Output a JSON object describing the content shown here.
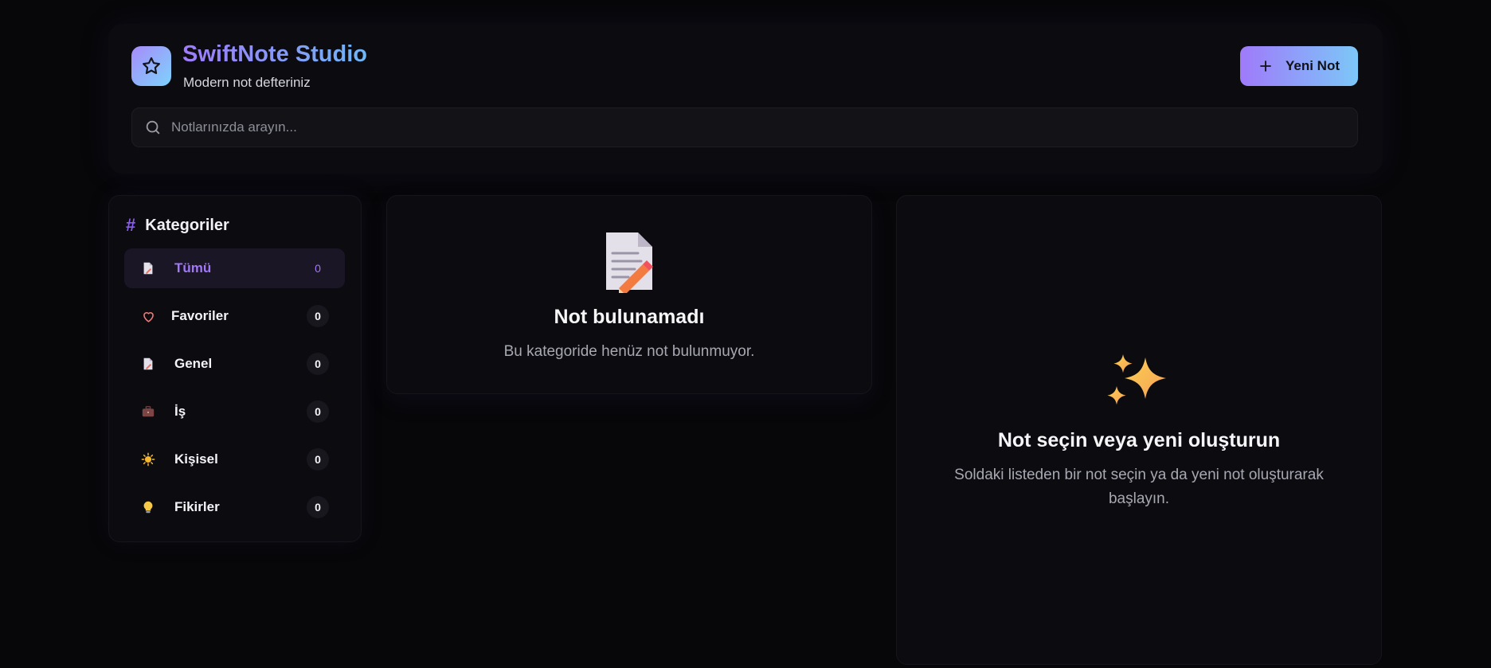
{
  "app": {
    "title": "SwiftNote Studio",
    "subtitle": "Modern not defteriniz",
    "logo_icon": "star-icon"
  },
  "header": {
    "new_note_label": "Yeni Not",
    "new_note_icon": "plus-icon"
  },
  "search": {
    "placeholder": "Notlarınızda arayın...",
    "value": ""
  },
  "sidebar": {
    "heading": "Kategoriler",
    "heading_icon": "hash-icon",
    "items": [
      {
        "label": "Tümü",
        "count": "0",
        "icon": "memo-icon",
        "active": true
      },
      {
        "label": "Favoriler",
        "count": "0",
        "icon": "heart-icon",
        "active": false
      },
      {
        "label": "Genel",
        "count": "0",
        "icon": "memo-icon",
        "active": false
      },
      {
        "label": "İş",
        "count": "0",
        "icon": "briefcase-icon",
        "active": false
      },
      {
        "label": "Kişisel",
        "count": "0",
        "icon": "sun-icon",
        "active": false
      },
      {
        "label": "Fikirler",
        "count": "0",
        "icon": "lightbulb-icon",
        "active": false
      }
    ]
  },
  "note_list": {
    "empty_icon": "memo-icon",
    "empty_title": "Not bulunamadı",
    "empty_text": "Bu kategoride henüz not bulunmuyor."
  },
  "detail": {
    "empty_icon": "sparkles-icon",
    "empty_title": "Not seçin veya yeni oluşturun",
    "empty_text": "Soldaki listeden bir not seçin ya da yeni not oluşturarak başlayın."
  },
  "colors": {
    "background": "#070709",
    "panel": "#0b0b10",
    "accent_purple": "#9f7afa",
    "accent_blue": "#7cc7f8",
    "active_item_bg": "#1a1626"
  }
}
